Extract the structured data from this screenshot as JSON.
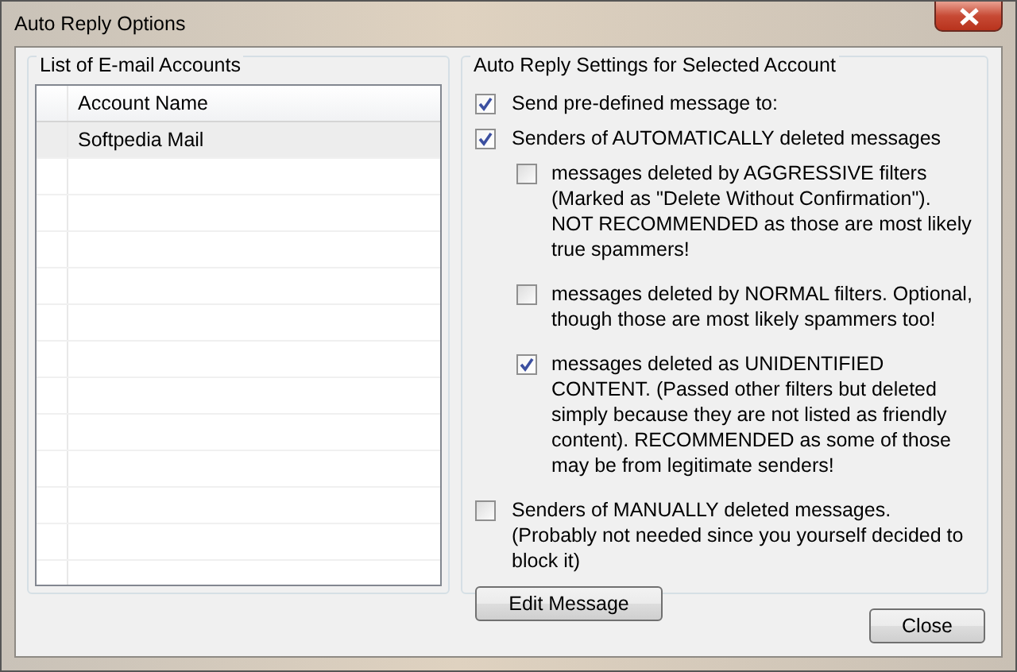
{
  "window": {
    "title": "Auto Reply Options"
  },
  "accounts": {
    "title": "List of E-mail Accounts",
    "columns": [
      "Account Name"
    ],
    "rows": [
      {
        "name": "Softpedia Mail",
        "selected": true
      }
    ]
  },
  "settings": {
    "title": "Auto Reply Settings for Selected Account",
    "options": [
      {
        "label": "Send pre-defined message to:",
        "checked": true
      },
      {
        "label": "Senders of AUTOMATICALLY deleted messages",
        "checked": true,
        "children": [
          {
            "label": "messages deleted by AGGRESSIVE filters (Marked as \"Delete Without Confirmation\"). NOT RECOMMENDED as those are most likely true spammers!",
            "checked": false
          },
          {
            "label": "messages deleted by NORMAL filters. Optional, though those are most likely spammers too!",
            "checked": false
          },
          {
            "label": "messages deleted as UNIDENTIFIED CONTENT. (Passed other filters but deleted simply because they are not listed as friendly content). RECOMMENDED as some of those may be from legitimate senders!",
            "checked": true
          }
        ]
      },
      {
        "label": "Senders of MANUALLY deleted messages. (Probably not needed since you yourself decided to block it)",
        "checked": false
      }
    ],
    "button": "Edit Message"
  },
  "buttons": [
    "Close"
  ]
}
